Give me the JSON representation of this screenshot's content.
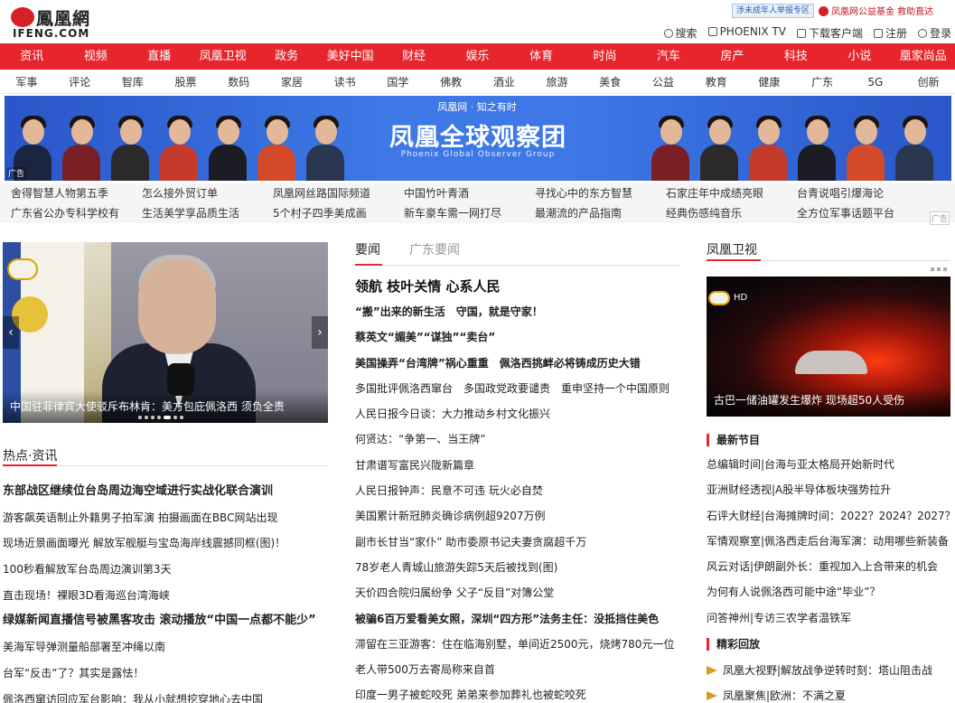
{
  "header": {
    "logo_cn": "鳳凰網",
    "logo_en": "IFENG.COM",
    "report_badge": "涉未成年人举报专区",
    "charity": "凤凰网公益基金 救助直达",
    "nav": [
      {
        "icon": "search-icon",
        "label": "搜索"
      },
      {
        "icon": "tv-icon",
        "label": "PHOENIX TV"
      },
      {
        "icon": "download-icon",
        "label": "下载客户端"
      },
      {
        "icon": "edit-icon",
        "label": "注册"
      },
      {
        "icon": "user-icon",
        "label": "登录"
      }
    ]
  },
  "main_nav": [
    "资讯",
    "视频",
    "直播",
    "凤凰卫视",
    "政务",
    "美好中国",
    "财经",
    "娱乐",
    "体育",
    "时尚",
    "汽车",
    "房产",
    "科技",
    "小说",
    "凰家尚品"
  ],
  "sub_nav": [
    "军事",
    "评论",
    "智库",
    "股票",
    "数码",
    "家居",
    "读书",
    "国学",
    "佛教",
    "酒业",
    "旅游",
    "美食",
    "公益",
    "教育",
    "健康",
    "广东",
    "5G",
    "创新"
  ],
  "banner": {
    "brand": "凤凰网 · 知之有时",
    "title": "凤凰全球观察团",
    "subtitle": "Phoenix Global Observer Group",
    "ad_tag": "广告"
  },
  "ad_links": {
    "row1": [
      "舍得智慧人物第五季",
      "怎么接外贸订单",
      "凤凰网丝路国际频道",
      "中国竹叶青酒",
      "寻找心中的东方智慧",
      "石家庄年中成绩亮眼",
      "台青说唱引爆海论"
    ],
    "row2": [
      "广东省公办专科学校有",
      "生活美学享品质生活",
      "5个村子四季美成画",
      "新车豪车需一网打尽",
      "最潮流的产品指南",
      "经典伤感纯音乐",
      "全方位军事话题平台"
    ],
    "ad_tag": "广告"
  },
  "carousel": {
    "caption": "中国驻菲律宾大使驳斥布林肯：美方包庇佩洛西 须负全责",
    "prev": "‹",
    "next": "›"
  },
  "hot": {
    "title": "热点·资讯",
    "items": [
      {
        "text": "东部战区继续位台岛周边海空域进行实战化联合演训",
        "bold": true
      },
      {
        "text": "游客飙英语制止外籍男子拍军演 拍摄画面在BBC网站出现",
        "bold": false
      },
      {
        "text": "现场近景画面曝光 解放军舰艇与宝岛海岸线震撼同框(图)！",
        "bold": false
      },
      {
        "text": "100秒看解放军台岛周边演训第3天",
        "bold": false
      },
      {
        "text": "直击现场！裸眼3D看海巡台湾海峡",
        "bold": false
      },
      {
        "text": "绿媒新闻直播信号被黑客攻击 滚动播放“中国一点都不能少”",
        "bold": true
      },
      {
        "text": "美海军导弹测量船部署至冲绳以南",
        "bold": false
      },
      {
        "text": "台军“反击”了？其实是露怯！",
        "bold": false
      },
      {
        "text": "佩洛西窜访回应军台影响：我从小就想挖穿地心去中国",
        "bold": false
      }
    ]
  },
  "middle": {
    "tabs": [
      "要闻",
      "广东要闻"
    ],
    "headline": "领航 枝叶关情 心系人民",
    "items": [
      {
        "text": "“搬”出来的新生活　守国，就是守家！",
        "bold": true
      },
      {
        "text": "蔡英文“媚美”“谋独”“卖台”",
        "bold": true
      },
      {
        "text": "美国操弄“台湾牌”祸心重重　佩洛西挑衅必将铸成历史大错",
        "bold": true
      },
      {
        "text": "多国批评佩洛西窜台　多国政党政要谴责　重申坚持一个中国原则",
        "bold": false
      },
      {
        "text": "人民日报今日谈：大力推动乡村文化振兴",
        "bold": false
      },
      {
        "text": "何贤达：“争第一、当王牌”",
        "bold": false
      },
      {
        "text": "甘肃谱写富民兴陇新篇章",
        "bold": false
      },
      {
        "text": "人民日报钟声：民意不可违 玩火必自焚",
        "bold": false
      },
      {
        "text": "美国累计新冠肺炎确诊病例超9207万例",
        "bold": false
      },
      {
        "text": "副市长甘当“家仆” 助市委原书记夫妻贪腐超千万",
        "bold": false
      },
      {
        "text": "78岁老人青城山旅游失踪5天后被找到(图)",
        "bold": false
      },
      {
        "text": "天价四合院归属纷争 父子“反目”对簿公堂",
        "bold": false
      },
      {
        "text": "被骗6百万爱看美女照，深圳“四方形”法务主任：没抵挡住美色",
        "bold": true
      },
      {
        "text": "滞留在三亚游客：住在临海别墅，单间近2500元，烧烤780元一位",
        "bold": false
      },
      {
        "text": "老人带500万去寄局称来自首",
        "bold": false
      },
      {
        "text": "印度一男子被蛇咬死 弟弟来参加葬礼也被蛇咬死",
        "bold": false
      }
    ]
  },
  "right": {
    "title": "凤凰卫视",
    "video_caption": "古巴一储油罐发生爆炸 现场超50人受伤",
    "hd": "HD",
    "new_shows_title": "最新节目",
    "new_shows": [
      "总编辑时间|台海与亚太格局开始新时代",
      "亚洲财经透视|A股半导体板块强势拉升",
      "石评大财经|台海摊牌时间：2022？2024？2027？",
      "军情观察室|佩洛西走后台海军演：动用哪些新装备",
      "风云对话|伊朗副外长：重视加入上合带来的机会",
      "为何有人说佩洛西可能中途“毕业”？",
      "问答神州|专访三农学者温铁军"
    ],
    "replay_title": "精彩回放",
    "replays": [
      "凤凰大视野|解放战争逆转时刻：塔山阻击战",
      "凤凰聚焦|欧洲：不满之夏"
    ]
  },
  "colors": {
    "brand_red": "#e6262c",
    "link": "#222222"
  }
}
